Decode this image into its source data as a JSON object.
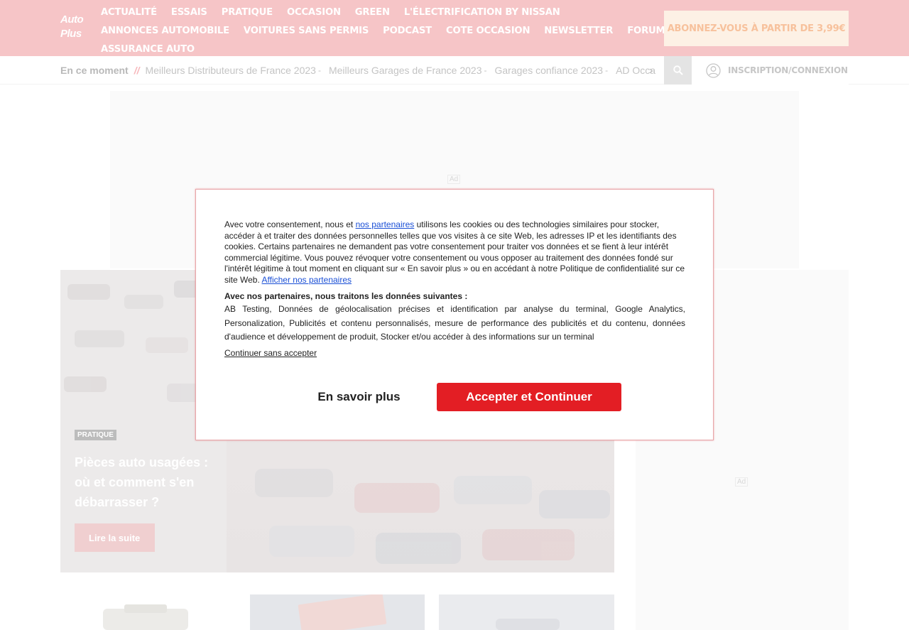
{
  "header": {
    "logo_line1": "Auto",
    "logo_line2": "Plus",
    "nav_row1": [
      "ACTUALITÉ",
      "ESSAIS",
      "PRATIQUE",
      "OCCASION",
      "GREEN",
      "L'ÉLECTRIFICATION BY NISSAN"
    ],
    "nav_row2": [
      "ANNONCES AUTOMOBILE",
      "VOITURES SANS PERMIS",
      "PODCAST",
      "COTE OCCASION",
      "NEWSLETTER",
      "FORUM"
    ],
    "nav_row3": [
      "ASSURANCE AUTO"
    ],
    "subscribe_label": "ABONNEZ-VOUS À PARTIR DE 3,99€"
  },
  "trending": {
    "label": "En ce moment",
    "separator": "//",
    "items": [
      "Meilleurs Distributeurs de France 2023",
      "Meilleurs Garages de France 2023",
      "Garages confiance 2023",
      "AD Occa"
    ],
    "dash": "-"
  },
  "login_label": "INSCRIPTION/CONNEXION",
  "ads": {
    "label": "Ad"
  },
  "hero": {
    "category": "PRATIQUE",
    "title": "Pièces auto usagées : où et comment s'en débarrasser ?",
    "cta": "Lire la suite"
  },
  "consent": {
    "intro_before_link": "Avec votre consentement, nous et ",
    "partners_link": "nos partenaires",
    "intro_after_link": " utilisons les cookies ou des technologies similaires pour stocker, accéder à et traiter des données personnelles telles que vos visites à ce site Web, les adresses IP et les identifiants des cookies. Certains partenaires ne demandent pas votre consentement pour traiter vos données et se fient à leur intérêt commercial légitime. Vous pouvez révoquer votre consentement ou vous opposer au traitement des données fondé sur l'intérêt légitime à tout moment en cliquant sur « En savoir plus » ou en accédant à notre Politique de confidentialité sur ce site Web. ",
    "show_partners_link": "Afficher nos partenaires",
    "purposes_heading": "Avec nos partenaires, nous traitons les données suivantes :",
    "purposes": "AB Testing, Données de géolocalisation précises et identification par analyse du terminal, Google Analytics, Personalization, Publicités et contenu personnalisés, mesure de performance des publicités et du contenu, données d'audience et développement de produit, Stocker et/ou accéder à des informations sur un terminal",
    "continue_without": "Continuer sans accepter",
    "more_button": "En savoir plus",
    "accept_button": "Accepter et Continuer"
  },
  "colors": {
    "header_bg": "#f6c5c7",
    "accept_red": "#e31e24",
    "link_blue": "#1a4fd6"
  }
}
